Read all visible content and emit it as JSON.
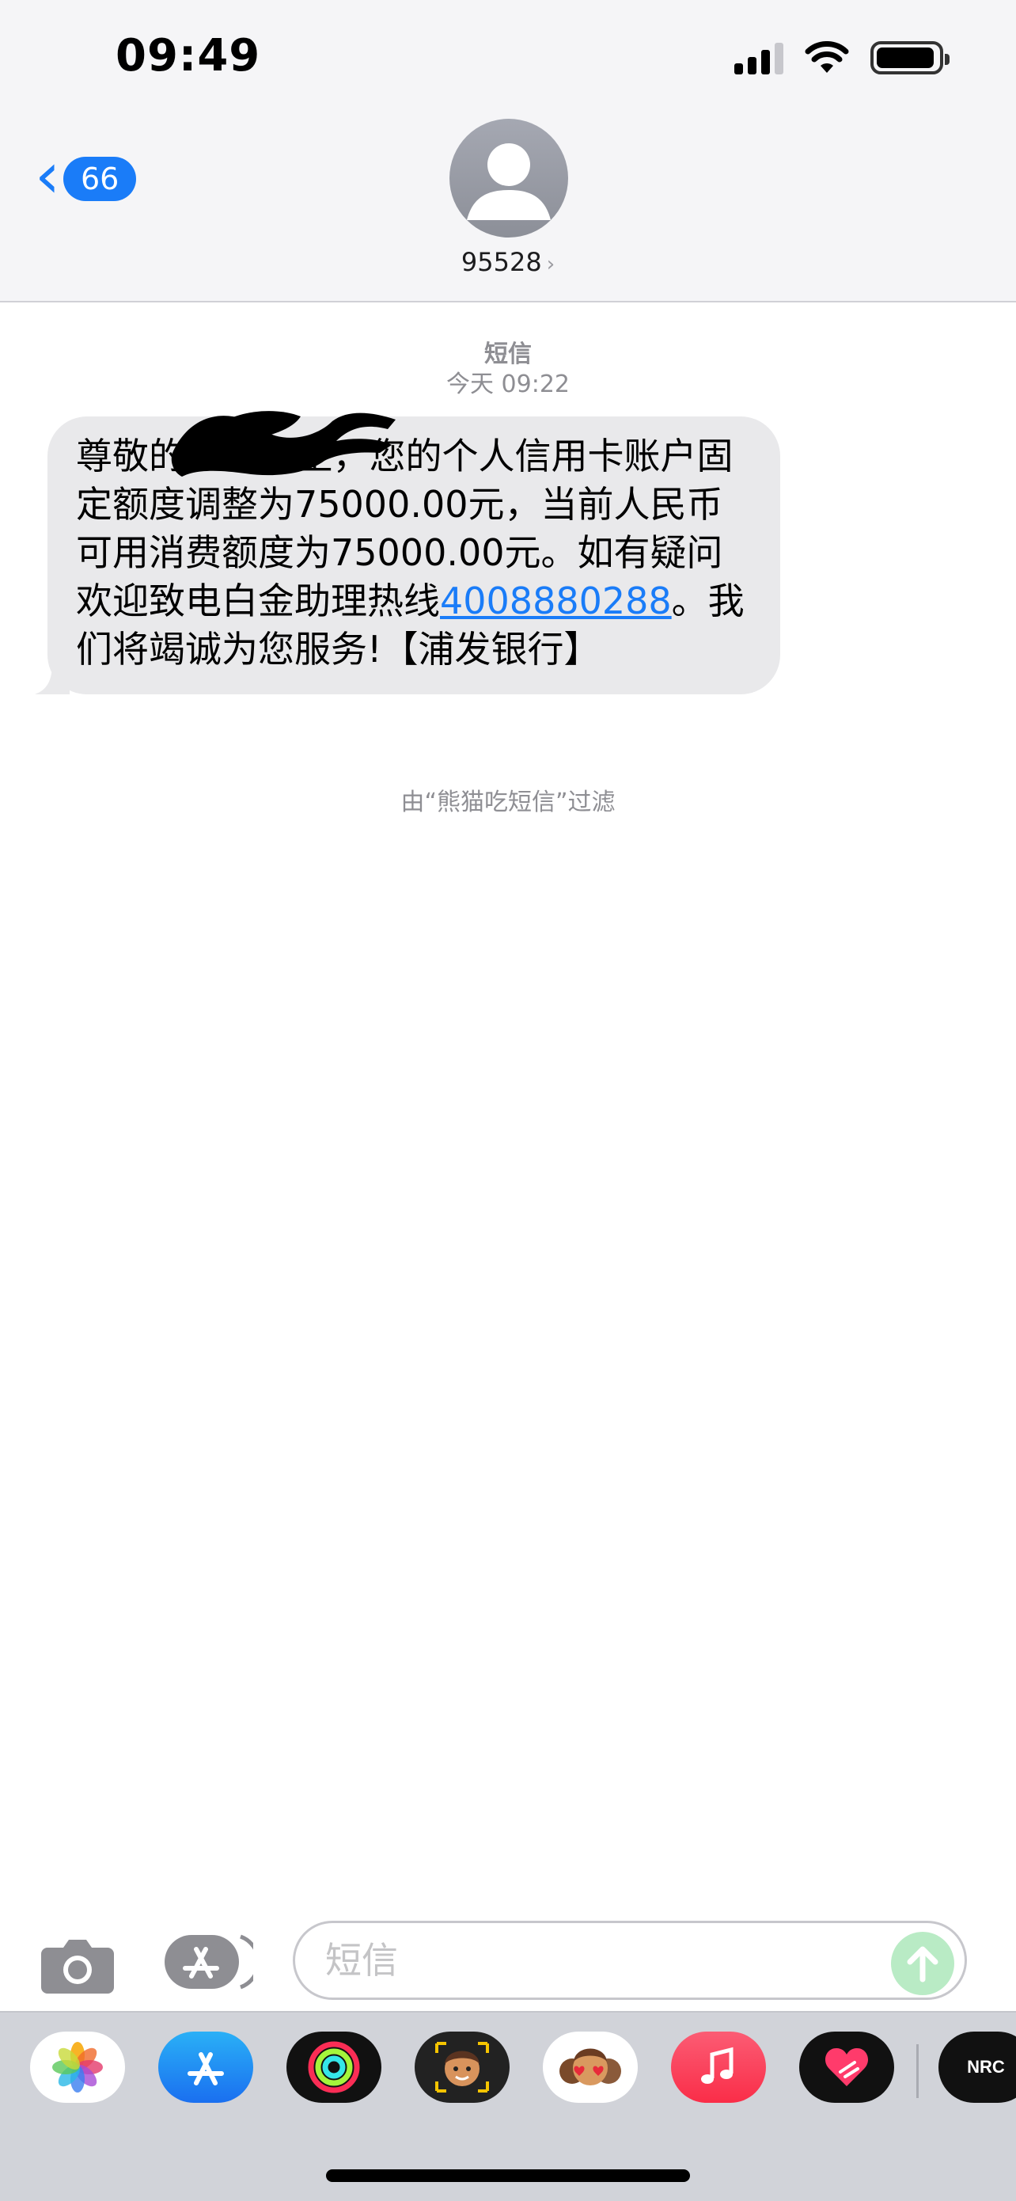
{
  "status_bar": {
    "time": "09:49",
    "signal_bars_active": 3,
    "signal_bars_total": 4,
    "wifi_icon": "wifi-icon",
    "battery_level": 0.95
  },
  "header": {
    "back_count": "66",
    "contact_name": "95528",
    "contact_arrow": "›"
  },
  "conversation": {
    "service_label": "短信",
    "timestamp": "今天 09:22",
    "message": {
      "text_before_link": "尊敬的XXX先生，您的个人信用卡账户固定额度调整为75000.00元，当前人民币可用消费额度为75000.00元。如有疑问欢迎致电白金助理热线",
      "link_text": "4008880288",
      "text_after_link": "。我们将竭诚为您服务!【浦发银行】",
      "redacted_name": true
    },
    "filter_note": "由“熊猫吃短信”过滤"
  },
  "composer": {
    "placeholder": "短信"
  },
  "app_drawer": {
    "apps": [
      "photos-app",
      "app-store-app",
      "fitness-app",
      "memoji-app",
      "animoji-app",
      "music-app",
      "digital-touch-app",
      "nike-run-club-app"
    ],
    "nrc_label": "NRC"
  },
  "colors": {
    "accent_blue": "#1a7cf8",
    "bubble_gray": "#e9e9eb",
    "header_bg": "#f5f5f7",
    "drawer_bg": "#d1d3d9",
    "send_green": "#b9ebc5",
    "music_red": "#fa3d50"
  }
}
